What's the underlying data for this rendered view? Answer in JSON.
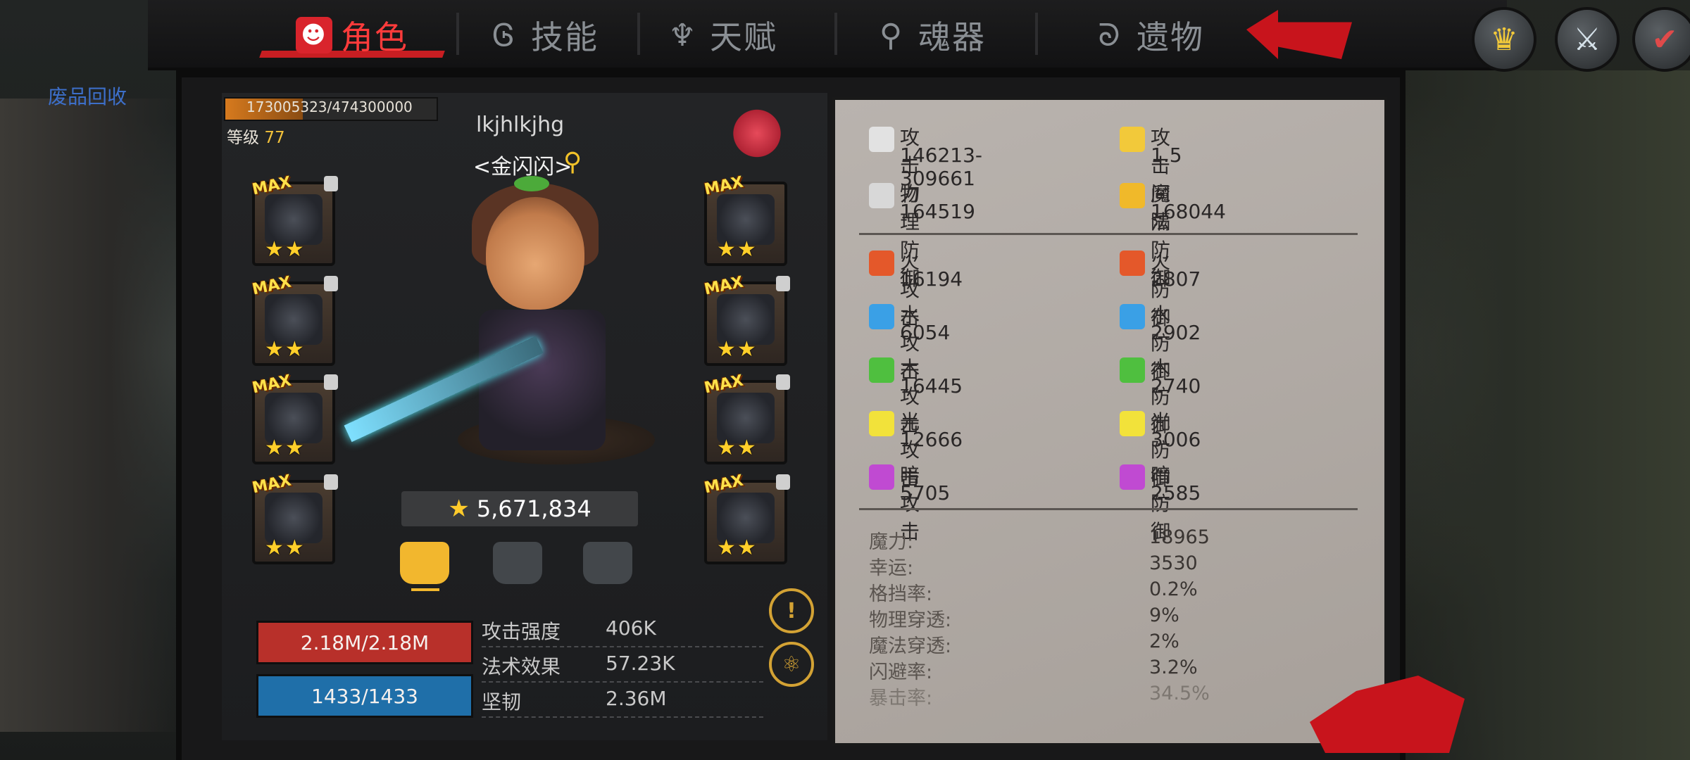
{
  "tabs": [
    {
      "label": "角色",
      "active": true,
      "icon": "demon-face-icon"
    },
    {
      "label": "技能",
      "active": false,
      "icon": "skill-swirl-icon"
    },
    {
      "label": "天赋",
      "active": false,
      "icon": "talent-flame-icon"
    },
    {
      "label": "魂器",
      "active": false,
      "icon": "soul-gem-icon"
    },
    {
      "label": "遗物",
      "active": false,
      "icon": "relic-spiral-icon"
    }
  ],
  "side_link": "废品回收",
  "character": {
    "exp_text": "173005323/474300000",
    "exp_progress": 0.365,
    "level_label": "等级",
    "level_value": "77",
    "name": "lkjhlkjhg",
    "guild": "<金闪闪>",
    "power": "5,671,834"
  },
  "equipment": {
    "max_label": "MAX",
    "stars": "★★",
    "left_slots": [
      "hat",
      "gloves",
      "weapon",
      "boots"
    ],
    "right_slots": [
      "shoulder",
      "armor",
      "leggings",
      "amulet"
    ]
  },
  "resources": {
    "hp": "2.18M/2.18M",
    "mp": "1433/1433"
  },
  "mini_stats": [
    {
      "label": "攻击强度",
      "value": "406K"
    },
    {
      "label": "法术效果",
      "value": "57.23K"
    },
    {
      "label": "坚韧",
      "value": "2.36M"
    }
  ],
  "main_stats": [
    {
      "label": "攻击力",
      "value": "146213-309661",
      "icon": "sword-icon",
      "color": "#e2e2e2"
    },
    {
      "label": "攻击间隔",
      "value": "1.5",
      "icon": "lightning-sword-icon",
      "color": "#f2c93a"
    },
    {
      "label": "物理防御",
      "value": "164519",
      "icon": "physical-shield-icon",
      "color": "#d8d8d8"
    },
    {
      "label": "魔法防御",
      "value": "168044",
      "icon": "magic-shield-icon",
      "color": "#f0b92a"
    }
  ],
  "element_stats": [
    {
      "label": "火攻击",
      "value": "16194",
      "icon": "fire-attack-icon",
      "color": "#e4582a"
    },
    {
      "label": "火防御",
      "value": "2807",
      "icon": "fire-defense-icon",
      "color": "#e4582a"
    },
    {
      "label": "水攻击",
      "value": "6054",
      "icon": "water-attack-icon",
      "color": "#3aa0e6"
    },
    {
      "label": "水防御",
      "value": "2902",
      "icon": "water-defense-icon",
      "color": "#3aa0e6"
    },
    {
      "label": "木攻击",
      "value": "16445",
      "icon": "wood-attack-icon",
      "color": "#4fbf3f"
    },
    {
      "label": "木防御",
      "value": "2740",
      "icon": "wood-defense-icon",
      "color": "#4fbf3f"
    },
    {
      "label": "光攻击",
      "value": "12666",
      "icon": "light-attack-icon",
      "color": "#f2e23a"
    },
    {
      "label": "光防御",
      "value": "3006",
      "icon": "light-defense-icon",
      "color": "#f2e23a"
    },
    {
      "label": "暗攻击",
      "value": "5705",
      "icon": "dark-attack-icon",
      "color": "#c04ad2"
    },
    {
      "label": "暗防御",
      "value": "2585",
      "icon": "dark-defense-icon",
      "color": "#c04ad2"
    }
  ],
  "extra_stats": [
    {
      "label": "魔力:",
      "value": "18965"
    },
    {
      "label": "幸运:",
      "value": "3530"
    },
    {
      "label": "格挡率:",
      "value": "0.2%"
    },
    {
      "label": "物理穿透:",
      "value": "9%"
    },
    {
      "label": "魔法穿透:",
      "value": "2%"
    },
    {
      "label": "闪避率:",
      "value": "3.2%"
    },
    {
      "label": "暴击率:",
      "value": "34.5%"
    }
  ],
  "icons": {
    "search": "⚲",
    "back": "↩",
    "hint": "!",
    "orbit": "⚛"
  },
  "colors": {
    "accent_red": "#d9242c",
    "gold": "#f2b72e",
    "hp": "#b8302a",
    "mp": "#1f6fa9"
  }
}
